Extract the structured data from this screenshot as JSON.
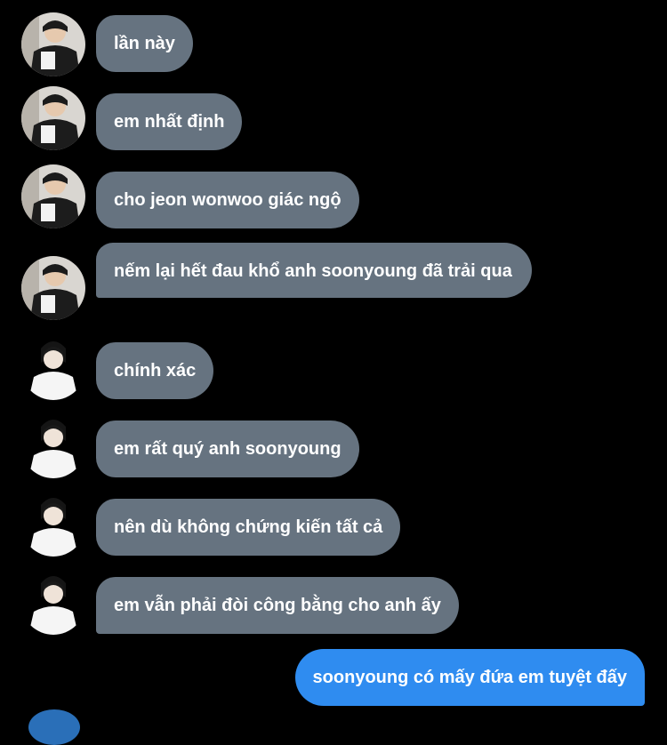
{
  "conversation": {
    "messages": [
      {
        "sender": "wonwoo",
        "text": "lần này"
      },
      {
        "sender": "wonwoo",
        "text": "em nhất định"
      },
      {
        "sender": "wonwoo",
        "text": "cho jeon wonwoo giác ngộ"
      },
      {
        "sender": "wonwoo",
        "text": "nếm lại hết đau khổ anh soonyoung đã trải qua"
      },
      {
        "sender": "other",
        "text": "chính xác"
      },
      {
        "sender": "other",
        "text": "em rất quý anh soonyoung"
      },
      {
        "sender": "other",
        "text": "nên dù không chứng kiến tất cả"
      },
      {
        "sender": "other",
        "text": "em vẫn phải đòi công bằng cho anh ấy"
      },
      {
        "sender": "me",
        "text": "soonyoung có mấy đứa em tuyệt đấy"
      }
    ]
  },
  "theme": {
    "background": "#000000",
    "incoming_bubble": "#667380",
    "outgoing_bubble": "#2f8cf0",
    "text_color": "#ffffff"
  }
}
